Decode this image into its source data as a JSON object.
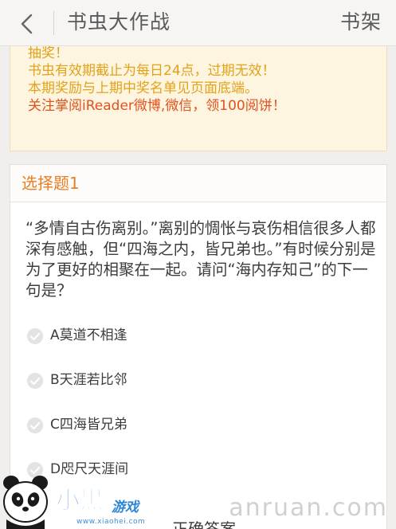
{
  "header": {
    "back_icon": "chevron-left-icon",
    "title": "书虫大作战",
    "right_label": "书架"
  },
  "notice": {
    "lines": [
      "抽奖！",
      "书虫有效期截止为每日24点，过期无效！",
      "本期奖励与上期中奖名单见页面底端。",
      "关注掌阅iReader微博,微信，领100阅饼！"
    ]
  },
  "question": {
    "label": "选择题1",
    "text": "“多情自古伤离别。”离别的惆怅与哀伤相信很多人都深有感触，但“四海之内，皆兄弟也。”有时候分别是为了更好的相聚在一起。请问“海内存知己”的下一句是？",
    "options": [
      {
        "label": "A莫道不相逢"
      },
      {
        "label": "B天涯若比邻"
      },
      {
        "label": "C四海皆兄弟"
      },
      {
        "label": "D咫尺天涯间"
      }
    ],
    "submit_label": "正确答案"
  },
  "watermark": {
    "logo_text": "小黑游戏",
    "logo_url": "www.xiaohei.com",
    "site": "anruan.com"
  },
  "colors": {
    "accent": "#e97e22",
    "notice_text": "#e3a21a",
    "notice_highlight": "#e0521f",
    "notice_bg": "#fdf5e0"
  }
}
